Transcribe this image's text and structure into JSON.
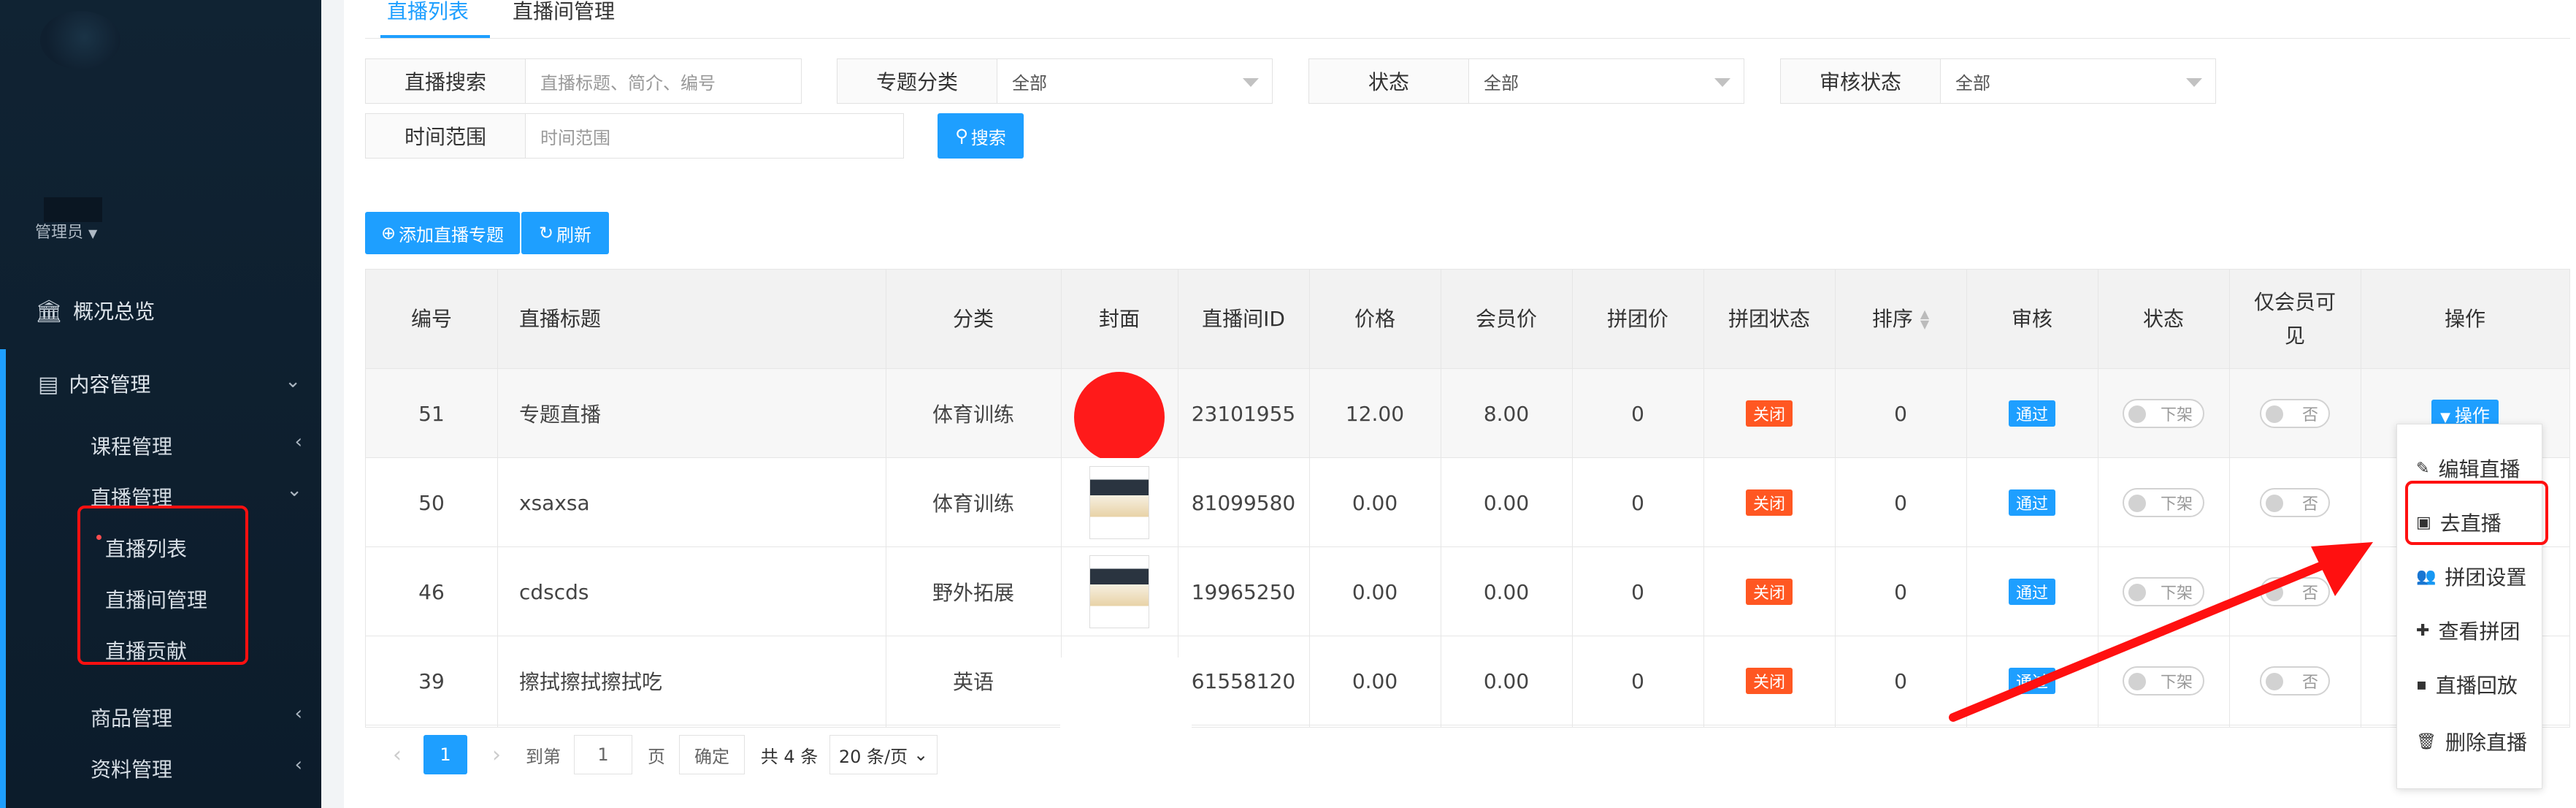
{
  "sidebar": {
    "role": "管理员",
    "items": [
      {
        "label": "概况总览",
        "icon": "bank-icon"
      },
      {
        "label": "内容管理",
        "icon": "newspaper-icon"
      }
    ],
    "sub": {
      "course": "课程管理",
      "live": "直播管理",
      "live_list": "直播列表",
      "live_room": "直播间管理",
      "live_contrib": "直播贡献",
      "goods": "商品管理",
      "resource": "资料管理"
    }
  },
  "tabs": [
    "直播列表",
    "直播间管理"
  ],
  "filters": {
    "search_label": "直播搜索",
    "search_placeholder": "直播标题、简介、编号",
    "category_label": "专题分类",
    "category_value": "全部",
    "status_label": "状态",
    "status_value": "全部",
    "audit_label": "审核状态",
    "audit_value": "全部",
    "time_label": "时间范围",
    "time_placeholder": "时间范围",
    "search_button": "搜索"
  },
  "toolbar": {
    "add_label": "添加直播专题",
    "refresh_label": "刷新"
  },
  "table": {
    "headers": [
      "编号",
      "直播标题",
      "分类",
      "封面",
      "直播间ID",
      "价格",
      "会员价",
      "拼团价",
      "拼团状态",
      "排序",
      "审核",
      "状态",
      "仅会员可见",
      "操作"
    ],
    "rows": [
      {
        "id": "51",
        "title": "专题直播",
        "category": "体育训练",
        "room_id": "23101955",
        "price": "12.00",
        "member_price": "8.00",
        "group_price": "0",
        "group_status": "关闭",
        "sort": "0",
        "audit": "通过",
        "status": "下架",
        "member_only": "否",
        "op": "操作"
      },
      {
        "id": "50",
        "title": "xsaxsa",
        "category": "体育训练",
        "room_id": "81099580",
        "price": "0.00",
        "member_price": "0.00",
        "group_price": "0",
        "group_status": "关闭",
        "sort": "0",
        "audit": "通过",
        "status": "下架",
        "member_only": "否"
      },
      {
        "id": "46",
        "title": "cdscds",
        "category": "野外拓展",
        "room_id": "19965250",
        "price": "0.00",
        "member_price": "0.00",
        "group_price": "0",
        "group_status": "关闭",
        "sort": "0",
        "audit": "通过",
        "status": "下架",
        "member_only": "否"
      },
      {
        "id": "39",
        "title": "擦拭擦拭擦拭吃",
        "category": "英语",
        "room_id": "61558120",
        "price": "0.00",
        "member_price": "0.00",
        "group_price": "0",
        "group_status": "关闭",
        "sort": "0",
        "audit": "通过",
        "status": "下架",
        "member_only": "否"
      }
    ]
  },
  "pagination": {
    "current": "1",
    "goto_label": "到第",
    "page_input": "1",
    "page_unit": "页",
    "confirm": "确定",
    "total": "共 4 条",
    "page_size": "20 条/页"
  },
  "op_menu": [
    "编辑直播",
    "去直播",
    "拼团设置",
    "查看拼团",
    "直播回放",
    "删除直播"
  ],
  "colors": {
    "sidebar_bg": "#0f1f2f",
    "primary": "#1e9fff",
    "danger": "#ff5722",
    "annotation": "#ff1010"
  }
}
